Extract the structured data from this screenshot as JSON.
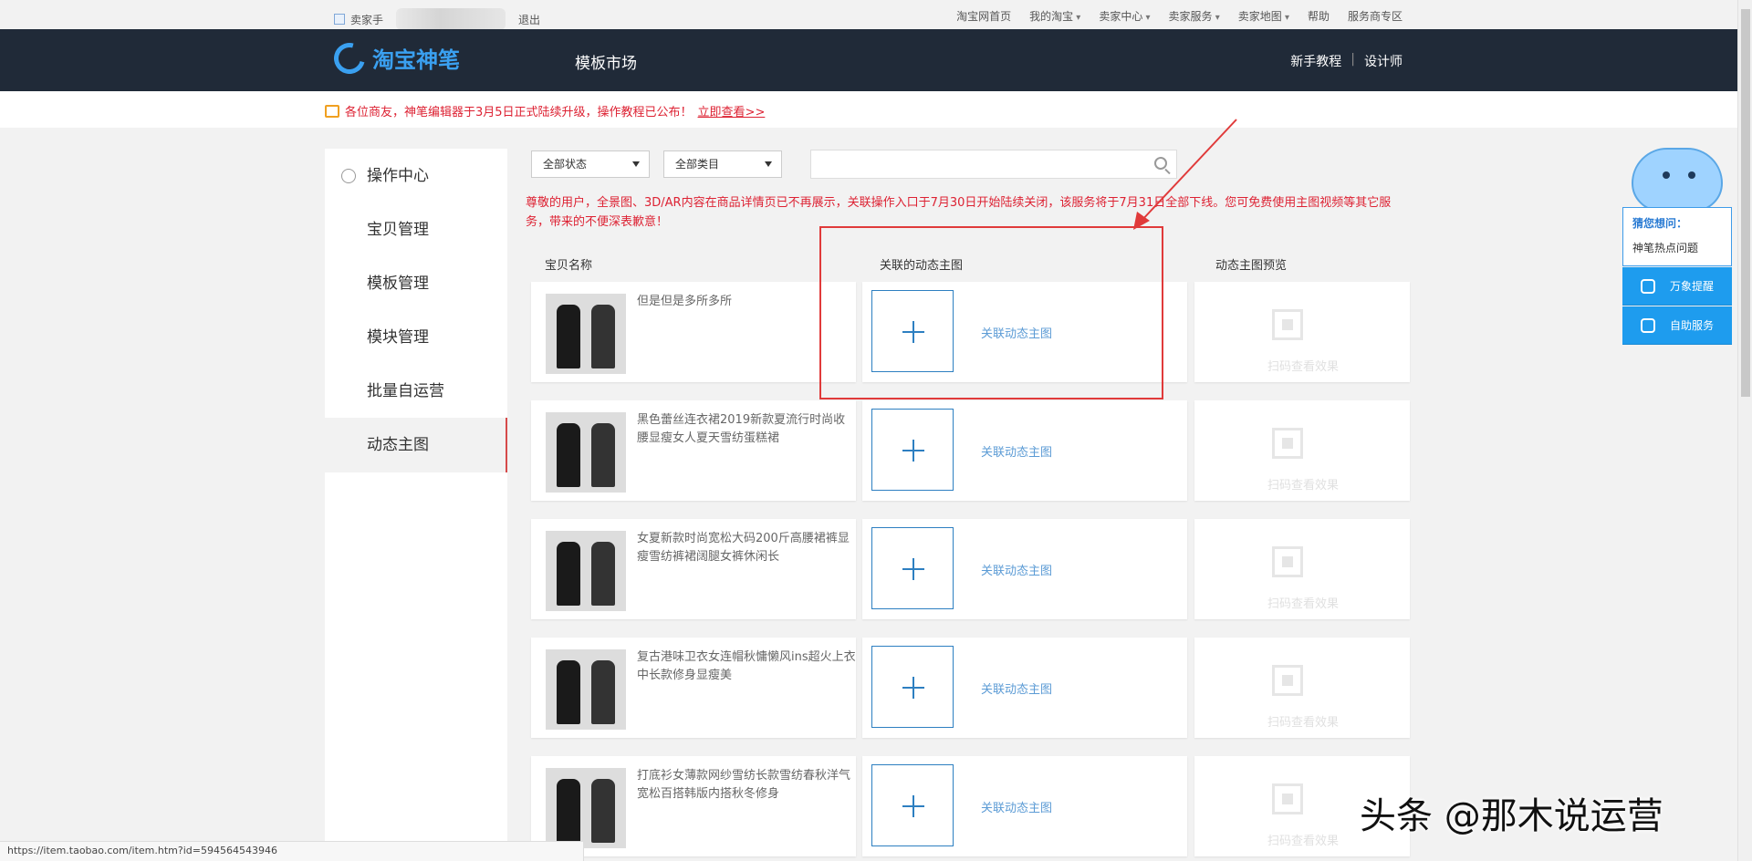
{
  "topbar": {
    "seller_partial": "卖家手",
    "logout": "退出",
    "links": [
      "淘宝网首页",
      "我的淘宝",
      "卖家中心",
      "卖家服务",
      "卖家地图",
      "帮助",
      "服务商专区"
    ]
  },
  "header": {
    "logo_text": "淘宝神笔",
    "market": "模板市场",
    "tutorial": "新手教程",
    "designer": "设计师"
  },
  "notice": {
    "text": "各位商友，神笔编辑器于3月5日正式陆续升级，操作教程已公布！",
    "link": "立即查看>>"
  },
  "sidebar": {
    "heading": "操作中心",
    "items": [
      "宝贝管理",
      "模板管理",
      "模块管理",
      "批量自运营",
      "动态主图"
    ],
    "active": "动态主图"
  },
  "filters": {
    "status": "全部状态",
    "category": "全部类目",
    "search_placeholder": ""
  },
  "warning": "尊敬的用户，全景图、3D/AR内容在商品详情页已不再展示，关联操作入口于7月30日开始陆续关闭，该服务将于7月31日全部下线。您可免费使用主图视频等其它服务，带来的不便深表歉意！",
  "columns": {
    "name": "宝贝名称",
    "linked": "关联的动态主图",
    "preview": "动态主图预览"
  },
  "rows": [
    {
      "name": "但是但是多所多所",
      "link": "关联动态主图",
      "qr_text": "扫码查看效果"
    },
    {
      "name": "黑色蕾丝连衣裙2019新款夏流行时尚收腰显瘦女人夏天雪纺蛋糕裙",
      "link": "关联动态主图",
      "qr_text": "扫码查看效果"
    },
    {
      "name": "女夏新款时尚宽松大码200斤高腰裙裤显瘦雪纺裤裙阔腿女裤休闲长",
      "link": "关联动态主图",
      "qr_text": "扫码查看效果"
    },
    {
      "name": "复古港味卫衣女连帽秋慵懒风ins超火上衣中长款修身显瘦美",
      "link": "关联动态主图",
      "qr_text": "扫码查看效果"
    },
    {
      "name": "打底衫女薄款网纱雪纺长款雪纺春秋洋气宽松百搭韩版内搭秋冬修身",
      "link": "关联动态主图",
      "qr_text": "扫码查看效果"
    }
  ],
  "float": {
    "question": "猜您想问：",
    "hot": "神笔热点问题",
    "btn1": "万象提醒",
    "btn2": "自助服务"
  },
  "status_url": "https://item.taobao.com/item.htm?id=594564543946",
  "watermark": "头条 @那木说运营",
  "colors": {
    "header_bg": "#202a38",
    "accent": "#2d7fc1",
    "warning": "#dd2233",
    "annotation": "#e03a3a"
  }
}
